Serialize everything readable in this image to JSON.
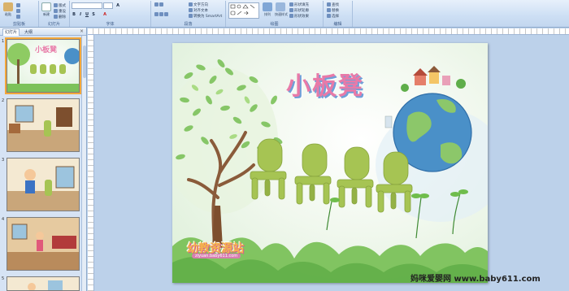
{
  "ribbon": {
    "groups": [
      {
        "label": "剪贴板"
      },
      {
        "label": "幻灯片"
      },
      {
        "label": "字体"
      },
      {
        "label": "段落"
      },
      {
        "label": "绘图"
      },
      {
        "label": "编辑"
      }
    ],
    "clipboard": {
      "paste_label": "粘贴"
    },
    "slides": {
      "new_slide_label": "新建",
      "layout_label": "版式",
      "reset_label": "重设",
      "delete_label": "删除"
    },
    "paragraph": {
      "text_direction_label": "文字方向",
      "align_text_label": "对齐文本",
      "convert_smartart_label": "转换为 SmartArt"
    },
    "drawing": {
      "arrange_label": "排列",
      "quick_styles_label": "快速样式",
      "shape_fill_label": "形状填充",
      "shape_outline_label": "形状轮廓",
      "shape_effects_label": "形状效果"
    },
    "editing": {
      "find_label": "查找",
      "replace_label": "替换",
      "select_label": "选择"
    },
    "format": {
      "bold": "B",
      "italic": "I",
      "underline": "U",
      "strike": "S",
      "grow": "A"
    }
  },
  "left_pane": {
    "tabs": [
      {
        "label": "幻灯片"
      },
      {
        "label": "大纲"
      }
    ],
    "close": "×",
    "thumbnails": [
      {
        "num": "1",
        "selected": true
      },
      {
        "num": "2",
        "selected": false
      },
      {
        "num": "3",
        "selected": false
      },
      {
        "num": "4",
        "selected": false
      },
      {
        "num": "5",
        "selected": false
      }
    ]
  },
  "slide": {
    "title": "小板凳",
    "logo_text": "幼教资源站",
    "logo_url": "ziyuan.baby611.com"
  },
  "watermark": "妈咪爱婴网  www.baby611.com",
  "colors": {
    "title_pink": "#e87aa8",
    "accent_blue": "#6fa0d8",
    "chair_green": "#a6c453",
    "leaf_green": "#7cc25a"
  }
}
